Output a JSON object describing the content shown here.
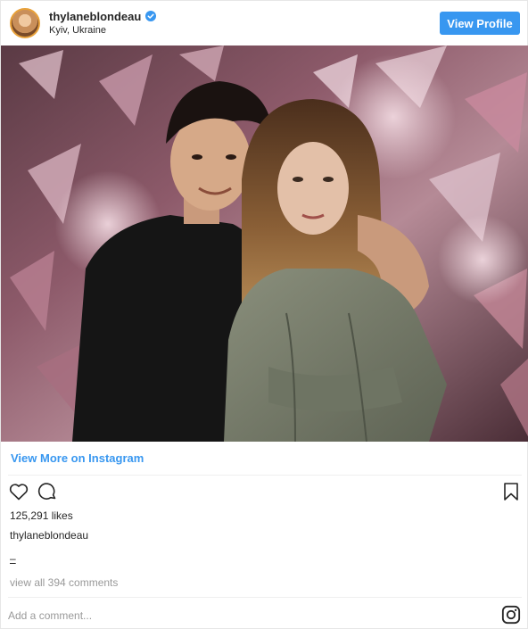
{
  "header": {
    "username": "thylaneblondeau",
    "location": "Kyiv, Ukraine",
    "verified": true,
    "view_profile_label": "View Profile"
  },
  "photo": {
    "alt": ""
  },
  "links": {
    "view_more_label": "View More on Instagram"
  },
  "actions": {
    "like_icon": "heart-outline-icon",
    "comment_icon": "comment-bubble-icon",
    "save_icon": "bookmark-icon"
  },
  "stats": {
    "likes_text": "125,291 likes"
  },
  "caption": {
    "username": "thylaneblondeau",
    "text": "–"
  },
  "comments": {
    "view_all_text": "view all 394 comments",
    "add_placeholder": "Add a comment..."
  },
  "colors": {
    "accent": "#3897f0",
    "muted": "#999999",
    "text": "#262626"
  }
}
